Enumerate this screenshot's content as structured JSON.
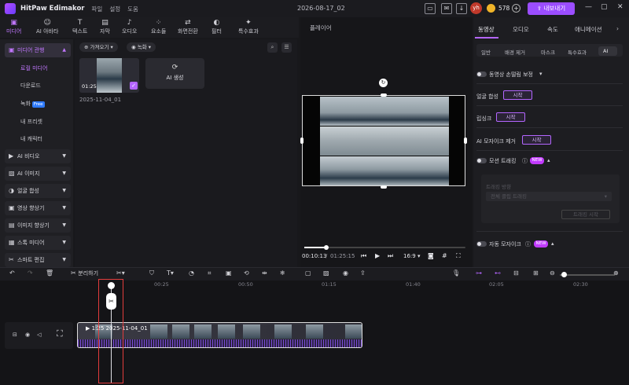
{
  "app": {
    "title": "HitPaw Edimakor",
    "menu": [
      "파일",
      "설정",
      "도움"
    ],
    "project_title": "2026-08-17_02",
    "user_initials": "yh",
    "coins": "578",
    "export_label": "내보내기"
  },
  "toolbar": {
    "tabs": [
      {
        "label": "미디어",
        "icon": "folder-icon"
      },
      {
        "label": "AI 아바타",
        "icon": "avatar-icon"
      },
      {
        "label": "텍스트",
        "icon": "text-icon"
      },
      {
        "label": "자막",
        "icon": "subtitle-icon"
      },
      {
        "label": "오디오",
        "icon": "music-icon"
      },
      {
        "label": "요소들",
        "icon": "elements-icon"
      },
      {
        "label": "화면전환",
        "icon": "transition-icon"
      },
      {
        "label": "필터",
        "icon": "filter-icon"
      },
      {
        "label": "특수효과",
        "icon": "effects-icon"
      }
    ]
  },
  "sidebar": {
    "media_project": "미디어 관행",
    "local_media": "로컬 미디어",
    "download": "다운로드",
    "record": "녹화",
    "free_badge": "Free",
    "my_preset": "내 프리셋",
    "my_character": "내 캐릭터",
    "items": [
      "AI 비디오",
      "AI 이미지",
      "얼굴 합성",
      "영상 향상기",
      "이미지 향상기",
      "스톡 미디어",
      "스마트 편집"
    ]
  },
  "media": {
    "import_label": "가져오기",
    "record_label": "녹화",
    "thumb_duration": "01:25",
    "ai_generate": "AI 생성",
    "date_label": "2025-11-04_01"
  },
  "player": {
    "title": "플레이어",
    "current_time": "00:10:13",
    "total_time": "01:25:15",
    "aspect": "16:9"
  },
  "right_panel": {
    "tabs": [
      "동영상",
      "오디오",
      "속도",
      "애니메이션"
    ],
    "subtabs": [
      "일반",
      "배경 제거",
      "마스크",
      "특수효과",
      "AI"
    ],
    "stabilize_label": "동영상 손떨림 보정",
    "face_swap_label": "얼굴 합성",
    "lipsync_label": "립싱크",
    "ai_mosaic_remove_label": "AI 모자이크 제거",
    "motion_track_label": "모션 트래킹",
    "new_badge": "NEW",
    "start_label": "시작",
    "track_target_label": "트래킹 방향",
    "track_select": "전체 클립 트래킹",
    "track_start": "트래킹 시작",
    "auto_mosaic_label": "자동 모자이크"
  },
  "timeline_toolbar": {
    "split_label": "분리하기"
  },
  "timeline": {
    "ticks": [
      "00:25",
      "00:50",
      "01:15",
      "01:40",
      "02:05",
      "02:30"
    ],
    "clip_duration": "1:25",
    "clip_name": "2025-11-04_01"
  }
}
